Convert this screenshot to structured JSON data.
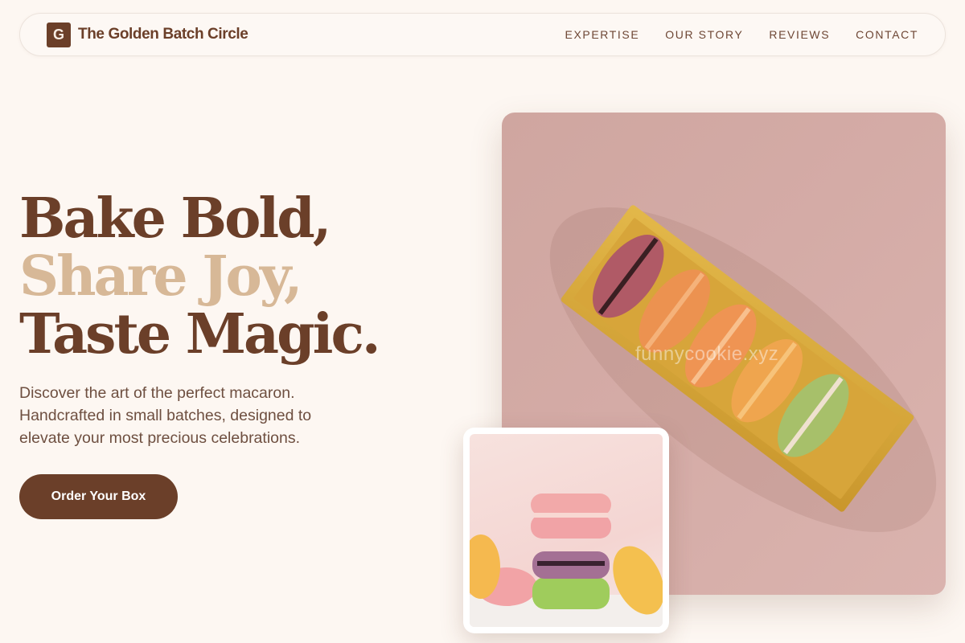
{
  "nav": {
    "logo_letter": "G",
    "brand": "The Golden Batch Circle",
    "items": [
      "EXPERTISE",
      "OUR STORY",
      "REVIEWS",
      "CONTACT"
    ]
  },
  "hero": {
    "line1": "Bake Bold,",
    "line2": "Share Joy,",
    "line3": "Taste Magic.",
    "description": "Discover the art of the perfect macaron. Handcrafted in small batches, designed to elevate your most precious celebrations.",
    "cta": "Order Your Box"
  },
  "images": {
    "main_watermark": "funnycookie.xyz",
    "main_alt": "macarons-in-golden-box",
    "small_alt": "stacked-macarons"
  },
  "colors": {
    "brand": "#6b3f29",
    "accent": "#d7b897",
    "background": "#fdf7f2"
  }
}
